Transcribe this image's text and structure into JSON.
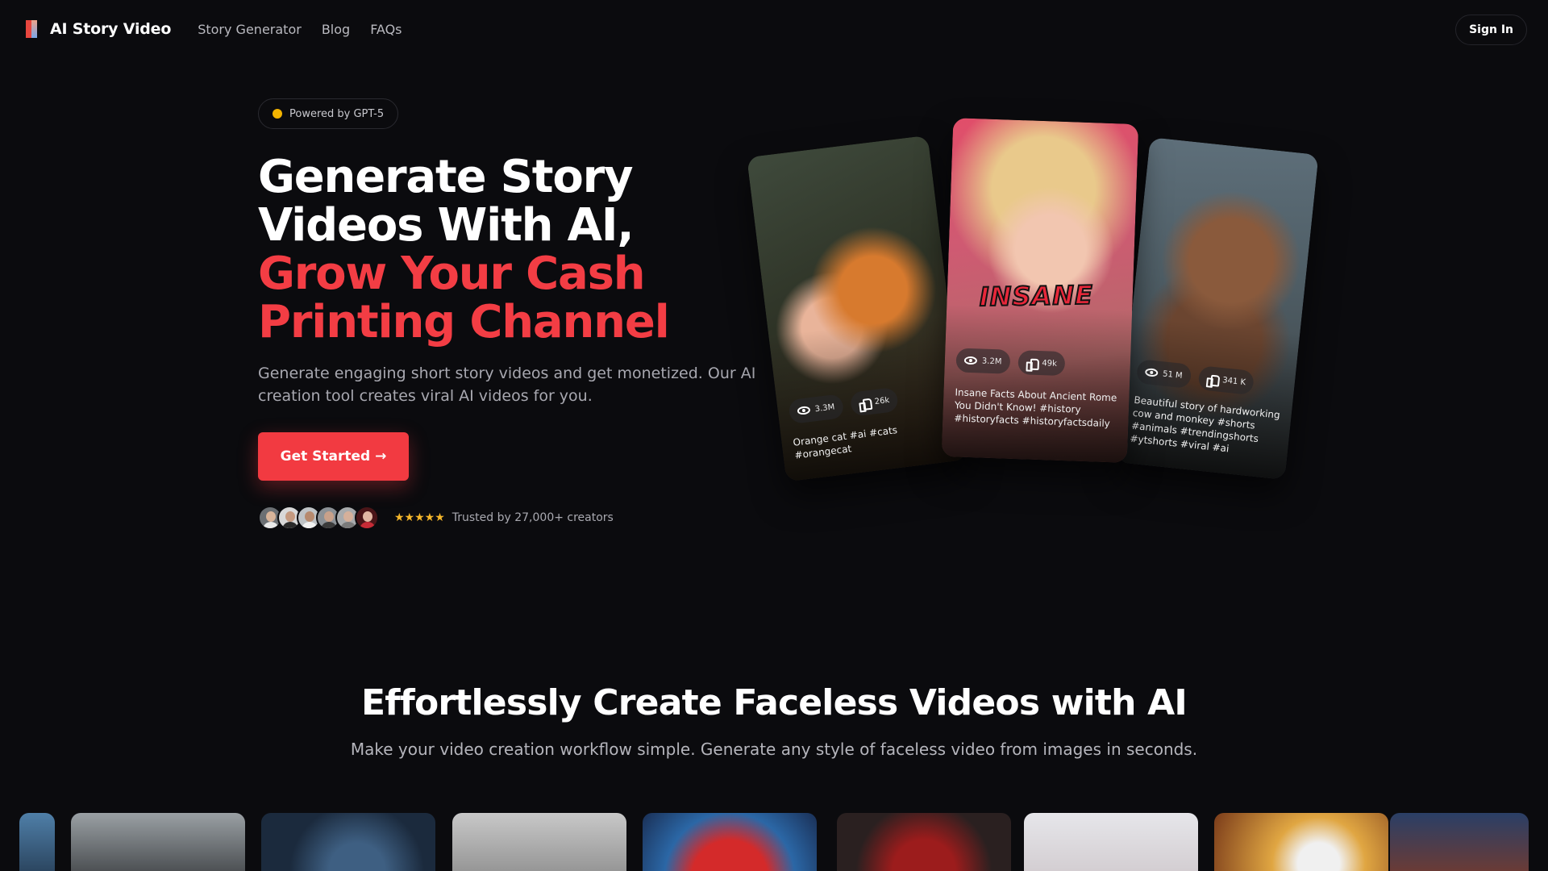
{
  "nav": {
    "brand": "AI Story Video",
    "links": [
      "Story Generator",
      "Blog",
      "FAQs"
    ],
    "signin": "Sign In"
  },
  "hero": {
    "badge": "Powered by GPT-5",
    "title_line1": "Generate Story",
    "title_line2": "Videos With AI,",
    "title_line3": "Grow Your Cash",
    "title_line4": "Printing Channel",
    "subtitle": "Generate engaging short story videos and get monetized. Our AI creation tool creates viral AI videos for you.",
    "cta": "Get Started →",
    "stars": "★★★★★",
    "trust": "Trusted by 27,000+ creators"
  },
  "cards": [
    {
      "views": "3.3M",
      "likes": "26k",
      "caption": "Orange cat #ai #cats #orangecat"
    },
    {
      "overlay": "INSANE",
      "views": "3.2M",
      "likes": "49k",
      "caption": "Insane Facts About Ancient Rome You Didn't Know! #history #historyfacts #historyfactsdaily"
    },
    {
      "views": "51 M",
      "likes": "341 K",
      "caption": "Beautiful story of hardworking cow and monkey #shorts #animals #trendingshorts #ytshorts #viral #ai"
    }
  ],
  "section": {
    "title": "Effortlessly Create Faceless Videos with AI",
    "subtitle": "Make your video creation workflow simple. Generate any style of faceless video from images in seconds."
  },
  "colors": {
    "accent": "#f23a41",
    "background": "#0b0b0e",
    "star": "#f5b72b",
    "badge_dot": "#f4b400"
  },
  "icons": [
    "eye-icon",
    "thumb-up-icon",
    "logo-icon",
    "star-icon"
  ]
}
